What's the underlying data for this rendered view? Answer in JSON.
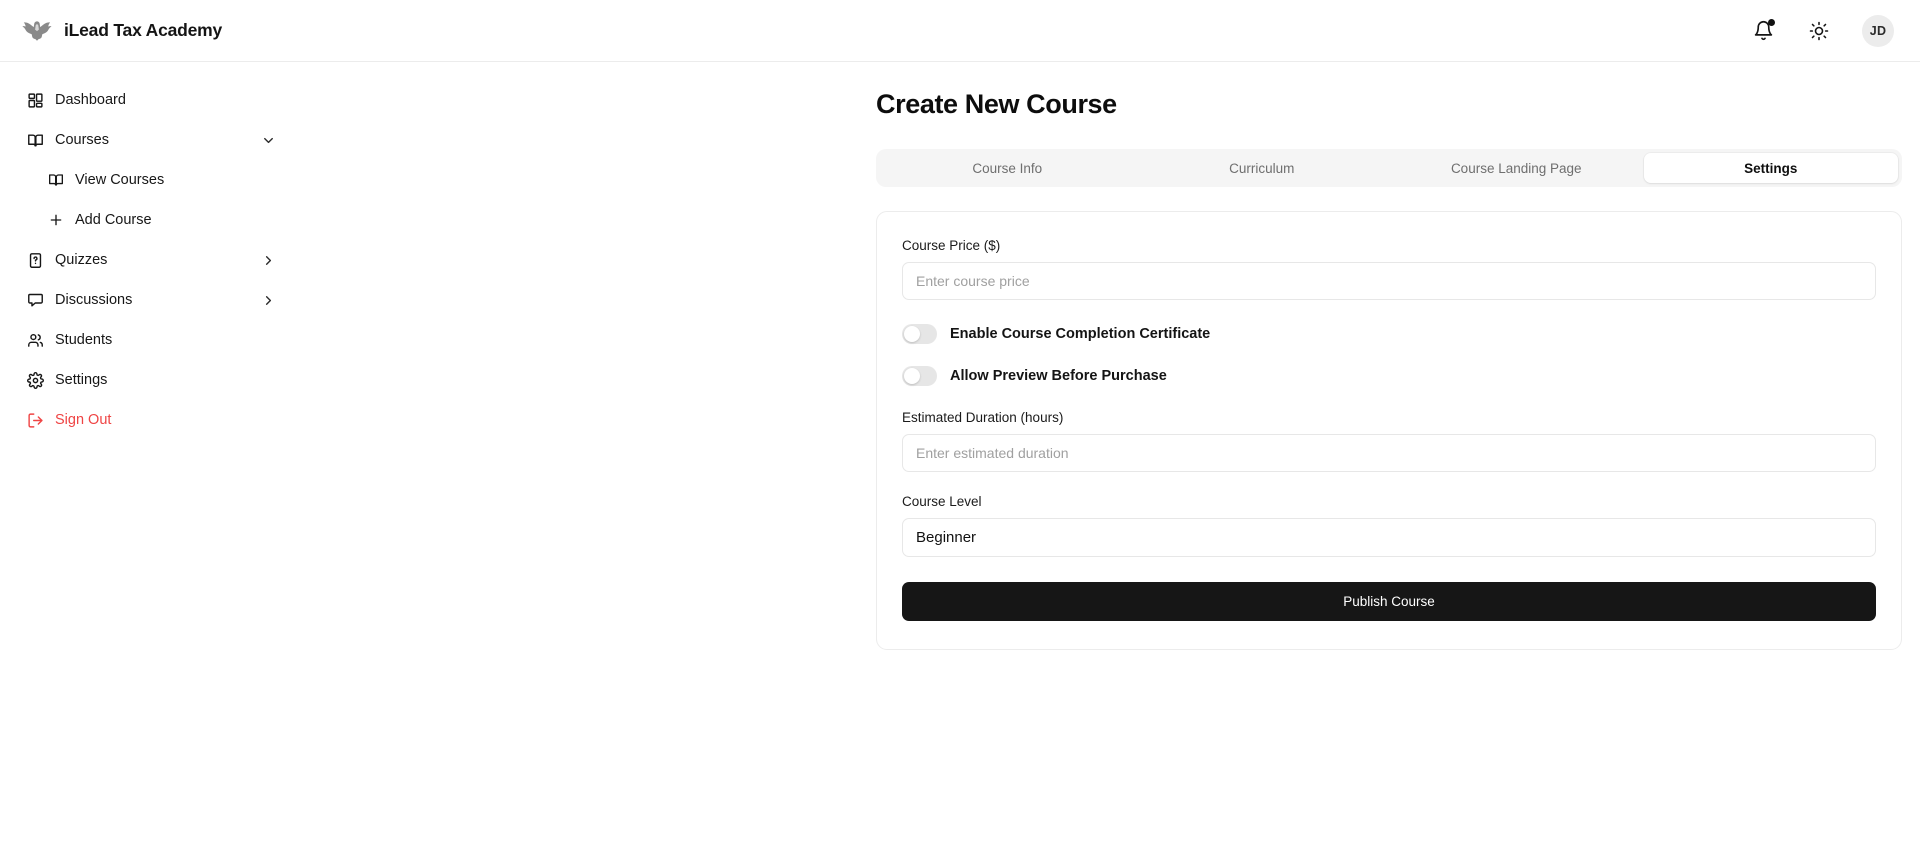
{
  "header": {
    "brand_name": "iLead Tax Academy",
    "logo_icon": "eagle-logo",
    "notifications_icon": "bell-icon",
    "theme_icon": "sun-icon",
    "avatar_initials": "JD",
    "notification_dot_color": "#111111"
  },
  "sidebar": {
    "items": [
      {
        "label": "Dashboard",
        "icon": "grid-icon",
        "type": "link"
      },
      {
        "label": "Courses",
        "icon": "book-icon",
        "type": "expandable",
        "chevron": "chevron-down-icon",
        "expanded": true
      },
      {
        "label": "View Courses",
        "icon": "book-icon",
        "type": "sub-link"
      },
      {
        "label": "Add Course",
        "icon": "plus-icon",
        "type": "sub-link"
      },
      {
        "label": "Quizzes",
        "icon": "quiz-file-icon",
        "type": "expandable",
        "chevron": "chevron-right-icon",
        "expanded": false
      },
      {
        "label": "Discussions",
        "icon": "chat-icon",
        "type": "expandable",
        "chevron": "chevron-right-icon",
        "expanded": false
      },
      {
        "label": "Students",
        "icon": "users-icon",
        "type": "link"
      },
      {
        "label": "Settings",
        "icon": "gear-icon",
        "type": "link"
      },
      {
        "label": "Sign Out",
        "icon": "logout-icon",
        "type": "link",
        "color": "#ef4444"
      }
    ]
  },
  "main": {
    "page_title": "Create New Course",
    "tabs": [
      {
        "label": "Course Info",
        "active": false
      },
      {
        "label": "Curriculum",
        "active": false
      },
      {
        "label": "Course Landing Page",
        "active": false
      },
      {
        "label": "Settings",
        "active": true
      }
    ],
    "settings_form": {
      "price": {
        "label": "Course Price ($)",
        "placeholder": "Enter course price",
        "value": ""
      },
      "certificate_toggle": {
        "label": "Enable Course Completion Certificate",
        "enabled": false
      },
      "preview_toggle": {
        "label": "Allow Preview Before Purchase",
        "enabled": false
      },
      "duration": {
        "label": "Estimated Duration (hours)",
        "placeholder": "Enter estimated duration",
        "value": ""
      },
      "level": {
        "label": "Course Level",
        "selected": "Beginner"
      },
      "publish_button": "Publish Course"
    }
  }
}
